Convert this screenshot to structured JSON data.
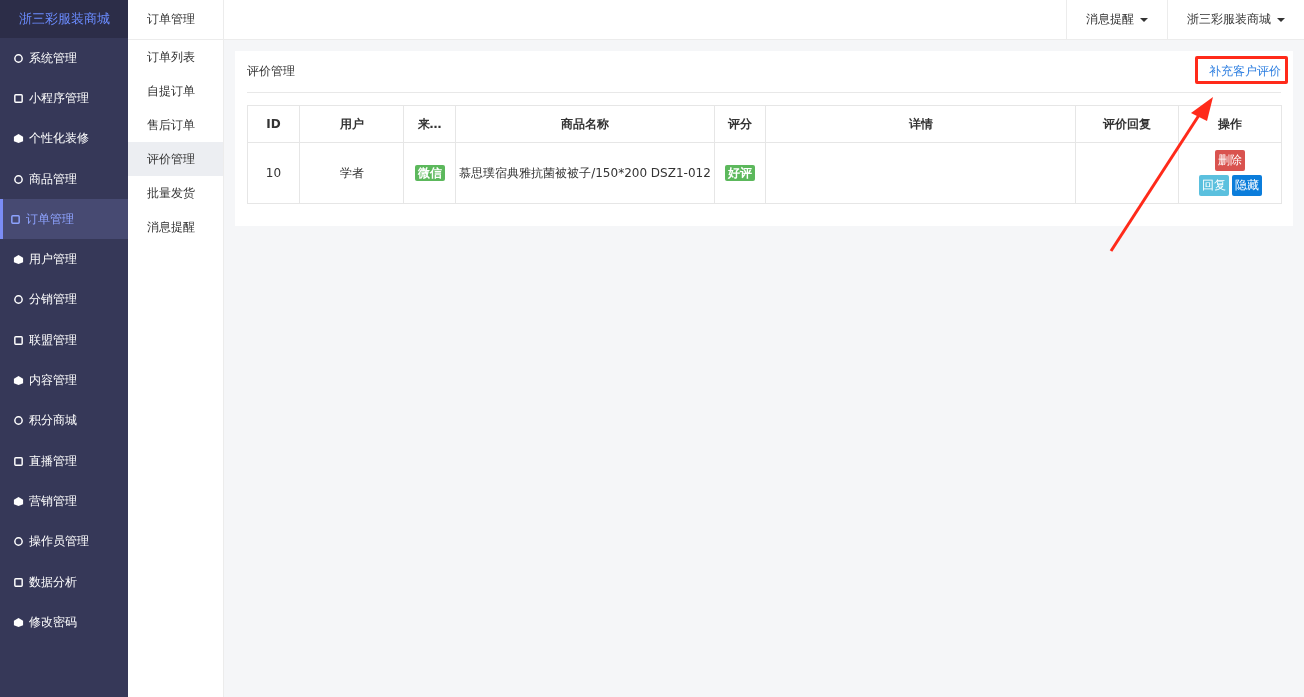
{
  "brand": "浙三彩服装商城",
  "sidebar": {
    "items": [
      {
        "label": "系统管理",
        "selected": false
      },
      {
        "label": "小程序管理",
        "selected": false
      },
      {
        "label": "个性化装修",
        "selected": false
      },
      {
        "label": "商品管理",
        "selected": false
      },
      {
        "label": "订单管理",
        "selected": true
      },
      {
        "label": "用户管理",
        "selected": false
      },
      {
        "label": "分销管理",
        "selected": false
      },
      {
        "label": "联盟管理",
        "selected": false
      },
      {
        "label": "内容管理",
        "selected": false
      },
      {
        "label": "积分商城",
        "selected": false
      },
      {
        "label": "直播管理",
        "selected": false
      },
      {
        "label": "营销管理",
        "selected": false
      },
      {
        "label": "操作员管理",
        "selected": false
      },
      {
        "label": "数据分析",
        "selected": false
      },
      {
        "label": "修改密码",
        "selected": false
      }
    ]
  },
  "submenu": {
    "title": "订单管理",
    "items": [
      {
        "label": "订单列表",
        "selected": false
      },
      {
        "label": "自提订单",
        "selected": false
      },
      {
        "label": "售后订单",
        "selected": false
      },
      {
        "label": "评价管理",
        "selected": true
      },
      {
        "label": "批量发货",
        "selected": false
      },
      {
        "label": "消息提醒",
        "selected": false
      }
    ]
  },
  "topbar": {
    "menus": [
      "消息提醒",
      "浙三彩服装商城"
    ]
  },
  "panel": {
    "title": "评价管理",
    "link": "补充客户评价"
  },
  "table": {
    "columns": [
      "ID",
      "用户",
      "来…",
      "商品名称",
      "评分",
      "详情",
      "评价回复",
      "操作"
    ],
    "rows": [
      {
        "id": "10",
        "user": "学者",
        "source": {
          "label": "微信",
          "color": "#5cb85c"
        },
        "product": "慕思璞宿典雅抗菌被被子/150*200 DSZ1-012",
        "rating": {
          "label": "好评",
          "color": "#5cb85c"
        },
        "actions": [
          {
            "label": "删除",
            "kind": "danger"
          },
          {
            "label": "回复",
            "kind": "info"
          },
          {
            "label": "隐藏",
            "kind": "primary"
          }
        ]
      }
    ]
  }
}
